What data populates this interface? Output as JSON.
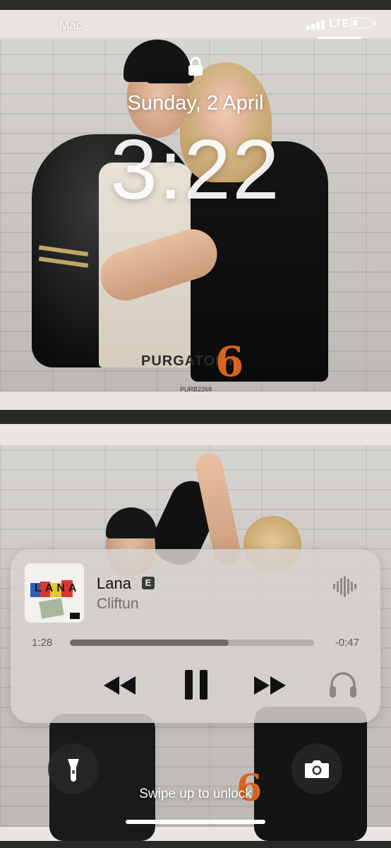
{
  "status_bar": {
    "carrier": "Mac",
    "network": "LTE",
    "battery_level": 0.25,
    "signal_bars": 4
  },
  "lock_screen": {
    "date": "Sunday, 2 April",
    "time": "3:22",
    "unlock_hint": "Swipe up to unlock"
  },
  "wallpaper": {
    "event_name": "PURGATORY",
    "event_number": "6",
    "photo_code": "PURB2269"
  },
  "now_playing": {
    "title": "Lana",
    "explicit_badge": "E",
    "artist": "Cliftun",
    "elapsed": "1:28",
    "remaining": "-0:47",
    "progress": 0.65,
    "artwork_text": "LANA"
  },
  "icons": {
    "lock": "lock-icon",
    "waveform": "waveform-icon",
    "rewind": "rewind-icon",
    "pause": "pause-icon",
    "forward": "fast-forward-icon",
    "airplay": "airpods-icon",
    "flashlight": "flashlight-icon",
    "camera": "camera-icon"
  },
  "colors": {
    "accent_orange": "#d9641e",
    "player_bg": "#d6d2ce",
    "control_dark": "#111111"
  }
}
